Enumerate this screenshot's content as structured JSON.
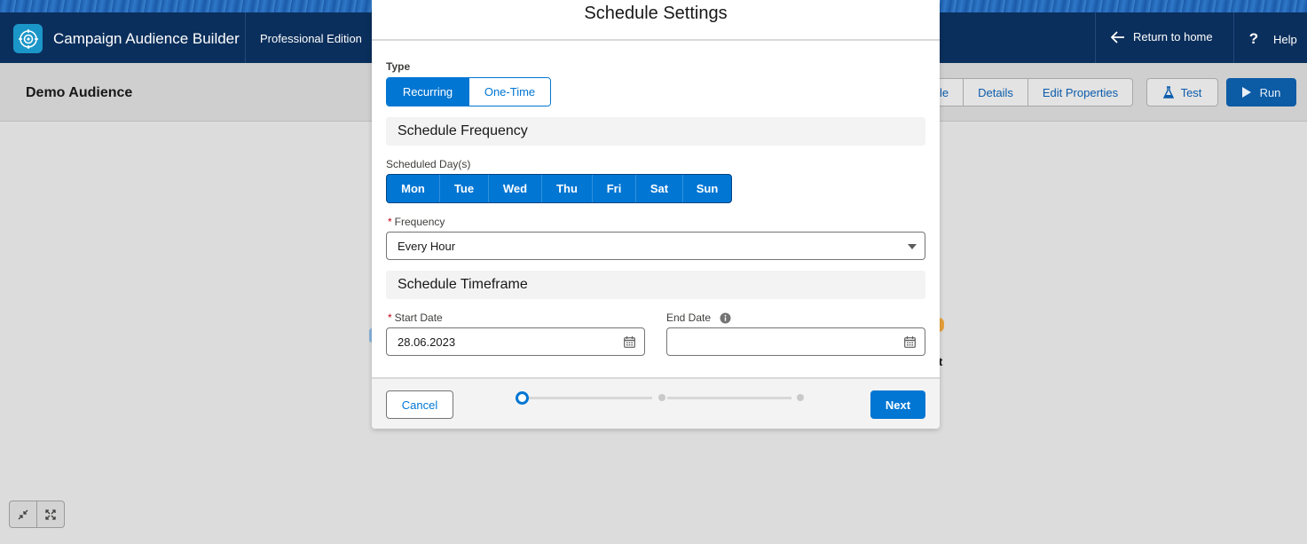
{
  "app": {
    "name": "Campaign Audience Builder",
    "edition": "Professional Edition",
    "return_home": "Return to home",
    "help": "Help"
  },
  "audience": {
    "title": "Demo Audience",
    "actions": [
      "le",
      "Details",
      "Edit Properties"
    ],
    "test_label": "Test",
    "run_label": "Run"
  },
  "modal": {
    "title": "Schedule Settings",
    "type_label": "Type",
    "type_options": [
      "Recurring",
      "One-Time"
    ],
    "type_selected": "Recurring",
    "frequency_section": "Schedule Frequency",
    "days_label": "Scheduled Day(s)",
    "days": [
      "Mon",
      "Tue",
      "Wed",
      "Thu",
      "Fri",
      "Sat",
      "Sun"
    ],
    "frequency_label": "Frequency",
    "frequency_value": "Every Hour",
    "timeframe_section": "Schedule Timeframe",
    "start_date_label": "Start Date",
    "start_date_value": "28.06.2023",
    "end_date_label": "End Date",
    "end_date_value": "",
    "required_marker": "*",
    "cancel_label": "Cancel",
    "next_label": "Next",
    "progress": {
      "current_step": 1,
      "total_steps": 3
    }
  },
  "canvas": {
    "peek_text": "t"
  },
  "colors": {
    "brand_blue": "#0176d3",
    "header_navy": "#0b2f5c",
    "required_red": "#ba0517"
  }
}
